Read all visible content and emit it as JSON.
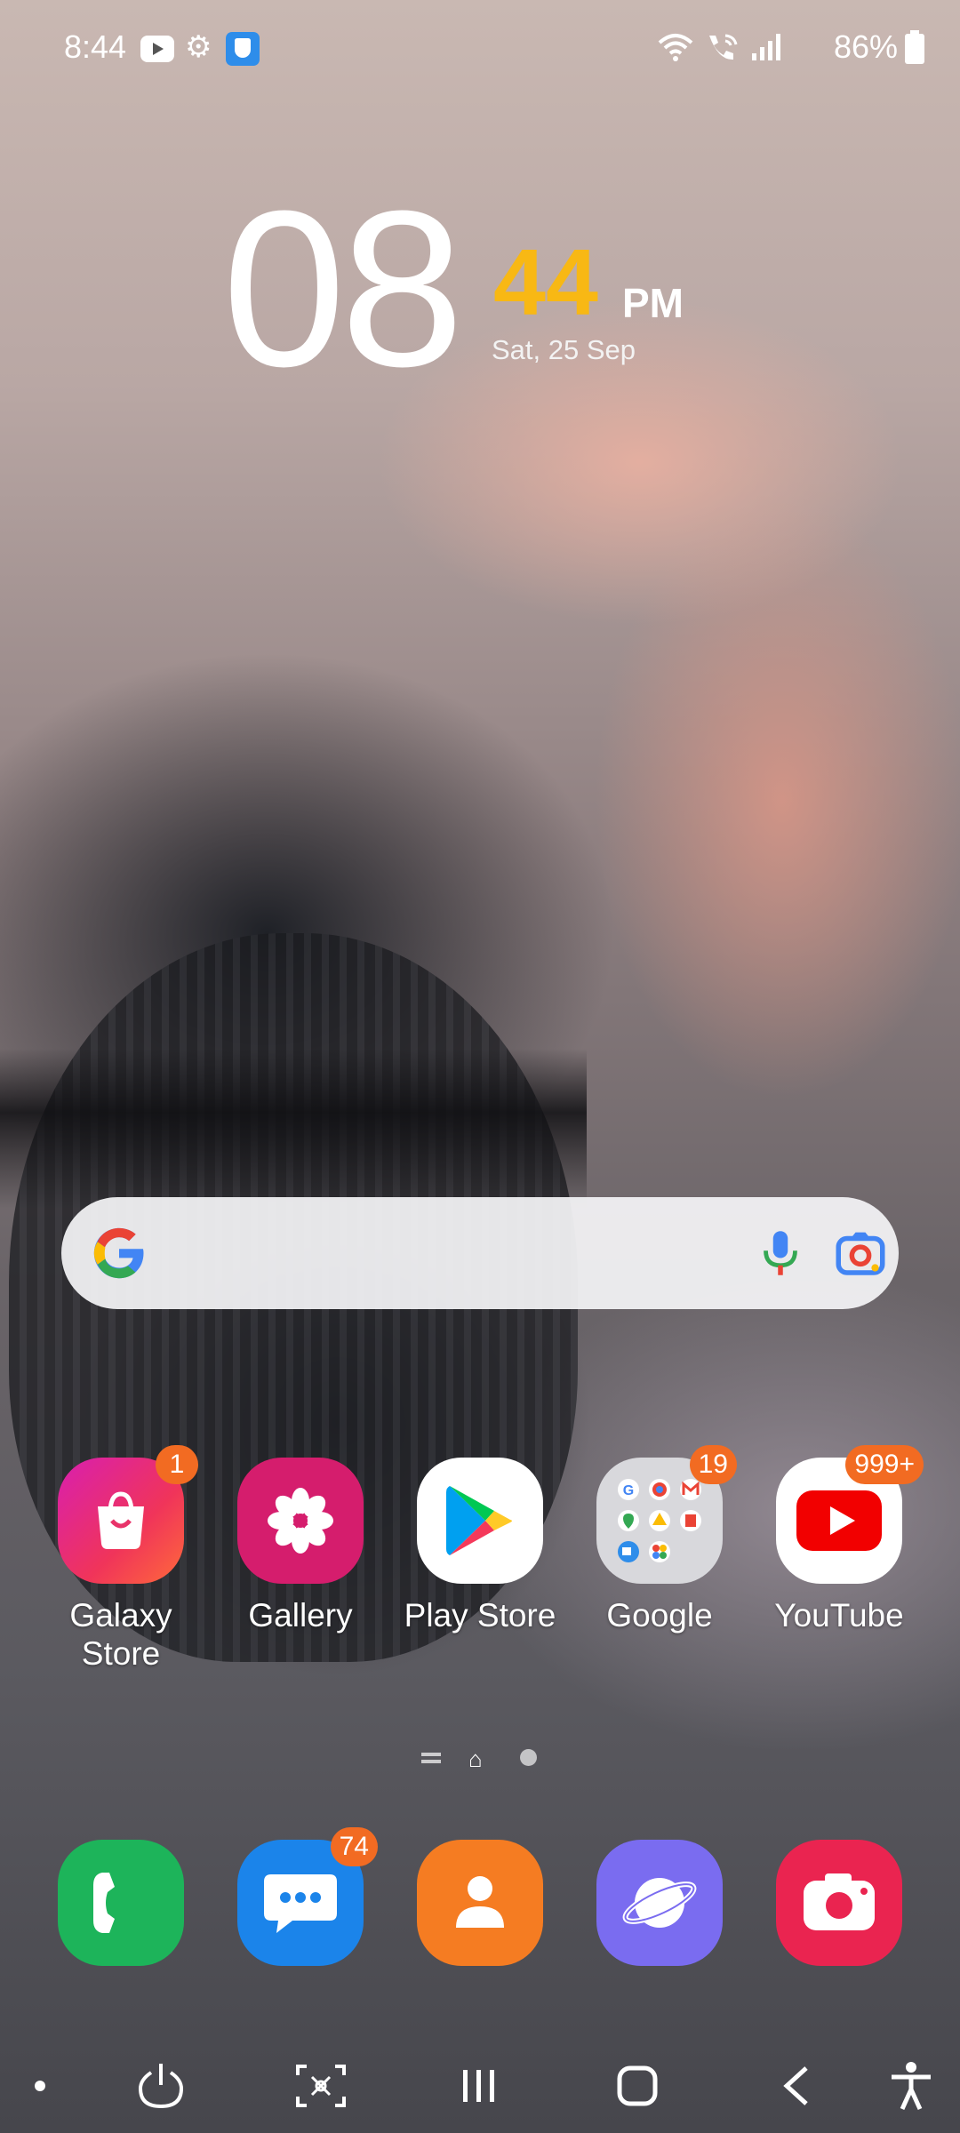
{
  "status_bar": {
    "time": "8:44",
    "battery": "86%",
    "icons": [
      "youtube-notification-icon",
      "settings-icon",
      "shield-icon",
      "wifi-icon",
      "wifi-calling-icon",
      "signal-icon",
      "battery-icon"
    ]
  },
  "clock": {
    "hour": "08",
    "minute": "44",
    "ampm": "PM",
    "date": "Sat, 25 Sep",
    "minute_color": "#f8b814"
  },
  "search_widget": {
    "icons": [
      "google-logo-icon",
      "microphone-icon",
      "google-lens-icon"
    ]
  },
  "apps": [
    {
      "label_line1": "Galaxy",
      "label_line2": "Store",
      "badge": "1",
      "color": "#e0285f"
    },
    {
      "label_line1": "Gallery",
      "label_line2": "",
      "badge": "",
      "color": "#d51d6d"
    },
    {
      "label_line1": "Play Store",
      "label_line2": "",
      "badge": "",
      "color": "#ffffff"
    },
    {
      "label_line1": "Google",
      "label_line2": "",
      "badge": "19",
      "color": "#d8d8dc"
    },
    {
      "label_line1": "YouTube",
      "label_line2": "",
      "badge": "999+",
      "color": "#ffffff"
    }
  ],
  "dock": {
    "apps": [
      {
        "name": "phone",
        "badge": "",
        "color": "#1db45a"
      },
      {
        "name": "messages",
        "badge": "74",
        "color": "#1b84ea"
      },
      {
        "name": "contacts",
        "badge": "",
        "color": "#f57c22"
      },
      {
        "name": "internet",
        "badge": "",
        "color": "#7a6cf0"
      },
      {
        "name": "camera",
        "badge": "",
        "color": "#ea2450"
      }
    ]
  },
  "navigation_bar": {
    "buttons": [
      "dot",
      "power",
      "screenshot",
      "recent-apps",
      "home",
      "back",
      "accessibility"
    ]
  },
  "badge_color": "#f26b22"
}
